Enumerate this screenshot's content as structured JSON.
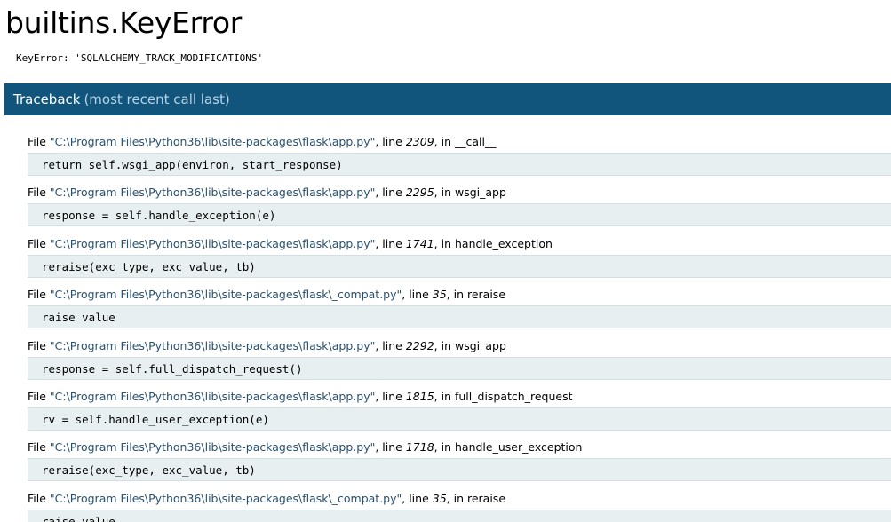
{
  "error": {
    "title": "builtins.KeyError",
    "message": "KeyError: 'SQLALCHEMY_TRACK_MODIFICATIONS'"
  },
  "traceback": {
    "title": "Traceback",
    "subtitle": "(most recent call last)",
    "frames": [
      {
        "file_prefix": "File ",
        "filename": "\"C:\\Program Files\\Python36\\lib\\site-packages\\flask\\app.py\"",
        "line_label": ", line ",
        "lineno": "2309",
        "in_label": ", in ",
        "function": "__call__",
        "code": "return self.wsgi_app(environ, start_response)"
      },
      {
        "file_prefix": "File ",
        "filename": "\"C:\\Program Files\\Python36\\lib\\site-packages\\flask\\app.py\"",
        "line_label": ", line ",
        "lineno": "2295",
        "in_label": ", in ",
        "function": "wsgi_app",
        "code": "response = self.handle_exception(e)"
      },
      {
        "file_prefix": "File ",
        "filename": "\"C:\\Program Files\\Python36\\lib\\site-packages\\flask\\app.py\"",
        "line_label": ", line ",
        "lineno": "1741",
        "in_label": ", in ",
        "function": "handle_exception",
        "code": "reraise(exc_type, exc_value, tb)"
      },
      {
        "file_prefix": "File ",
        "filename": "\"C:\\Program Files\\Python36\\lib\\site-packages\\flask\\_compat.py\"",
        "line_label": ", line ",
        "lineno": "35",
        "in_label": ", in ",
        "function": "reraise",
        "code": "raise value"
      },
      {
        "file_prefix": "File ",
        "filename": "\"C:\\Program Files\\Python36\\lib\\site-packages\\flask\\app.py\"",
        "line_label": ", line ",
        "lineno": "2292",
        "in_label": ", in ",
        "function": "wsgi_app",
        "code": "response = self.full_dispatch_request()"
      },
      {
        "file_prefix": "File ",
        "filename": "\"C:\\Program Files\\Python36\\lib\\site-packages\\flask\\app.py\"",
        "line_label": ", line ",
        "lineno": "1815",
        "in_label": ", in ",
        "function": "full_dispatch_request",
        "code": "rv = self.handle_user_exception(e)"
      },
      {
        "file_prefix": "File ",
        "filename": "\"C:\\Program Files\\Python36\\lib\\site-packages\\flask\\app.py\"",
        "line_label": ", line ",
        "lineno": "1718",
        "in_label": ", in ",
        "function": "handle_user_exception",
        "code": "reraise(exc_type, exc_value, tb)"
      },
      {
        "file_prefix": "File ",
        "filename": "\"C:\\Program Files\\Python36\\lib\\site-packages\\flask\\_compat.py\"",
        "line_label": ", line ",
        "lineno": "35",
        "in_label": ", in ",
        "function": "reraise",
        "code": "raise value"
      }
    ]
  },
  "colors": {
    "header_background": "#11557c",
    "code_background": "#e8eff0",
    "filename_text": "#29506f"
  }
}
